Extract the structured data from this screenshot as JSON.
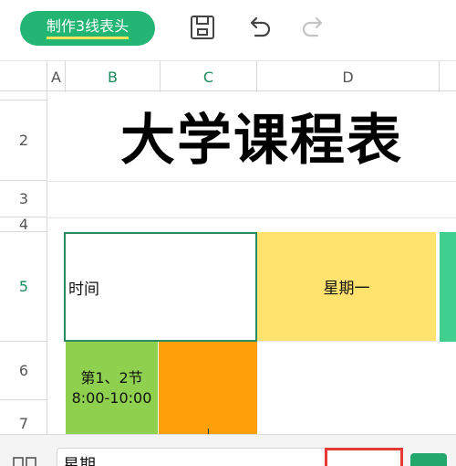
{
  "toolbar": {
    "pill_label": "制作3线表头",
    "icons": [
      "save-icon",
      "undo-icon",
      "redo-icon"
    ]
  },
  "columns": [
    "A",
    "B",
    "C",
    "D"
  ],
  "rows": [
    "2",
    "3",
    "4",
    "5",
    "6",
    "7"
  ],
  "sheet": {
    "title": "大学课程表",
    "cell_time": "时间",
    "cell_monday": "星期一",
    "cell_period_line1": "第1、2节",
    "cell_period_line2": "8:00-10:00"
  },
  "editbar": {
    "input_value": "星期"
  },
  "colors": {
    "accent": "#22b573",
    "yellow": "#ffe36e",
    "green_light": "#8fd14f",
    "orange": "#ff9f0a",
    "teal": "#3fcf8e",
    "highlight_red": "#e53935"
  }
}
